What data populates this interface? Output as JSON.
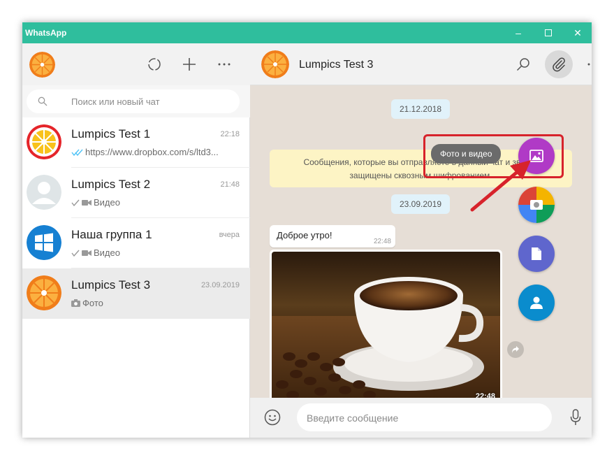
{
  "window": {
    "title": "WhatsApp",
    "minimize": "–",
    "maximize": "☐",
    "close": "✕"
  },
  "sidebar": {
    "search_placeholder": "Поиск или новый чат",
    "chats": [
      {
        "name": "Lumpics Test 1",
        "time": "22:18",
        "preview": "https://www.dropbox.com/s/ltd3...",
        "status": "double-check-read",
        "avatar": "orange-red-ring"
      },
      {
        "name": "Lumpics Test 2",
        "time": "21:48",
        "preview": "Видео",
        "status": "check",
        "avatar": "default-person"
      },
      {
        "name": "Наша группа 1",
        "time": "вчера",
        "preview": "Видео",
        "status": "check",
        "avatar": "windows-logo"
      },
      {
        "name": "Lumpics Test 3",
        "time": "23.09.2019",
        "preview": "Фото",
        "status": "camera",
        "avatar": "orange"
      }
    ]
  },
  "main": {
    "contact_name": "Lumpics Test 3",
    "date1": "21.12.2018",
    "system_message_line1": "Сообщения, которые вы отправляете в данный чат и звонки",
    "system_message_line2": "защищены сквозным шифрованием.",
    "date2": "23.09.2019",
    "message_text": "Доброе утро!",
    "message_time": "22:48",
    "photo_time": "22:48",
    "tooltip": "Фото и видео",
    "input_placeholder": "Введите сообщение"
  },
  "colors": {
    "titlebar": "#2fbe9d",
    "fab_gallery": "#b03ac6",
    "fab_camera": "multicolor",
    "fab_document": "#5f66cd",
    "fab_contact": "#0a8ccd",
    "highlight": "#d7232b"
  }
}
